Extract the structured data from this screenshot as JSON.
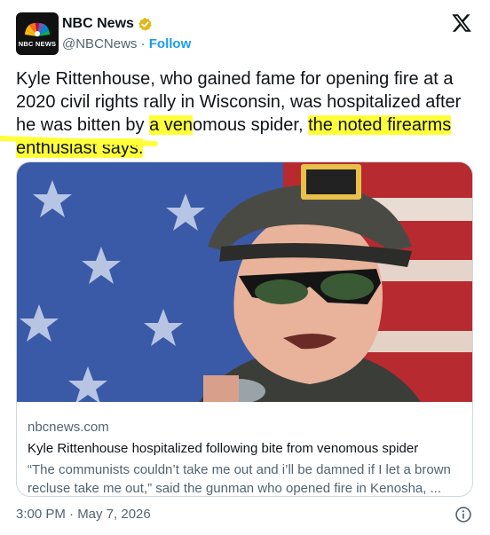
{
  "account": {
    "name": "NBC News",
    "handle": "@NBCNews",
    "separator": "·",
    "follow_label": "Follow",
    "avatar_text": "NBC NEWS"
  },
  "tweet": {
    "segments": {
      "s1": "Kyle Rittenhouse, who gained fame for opening fire at a 2020 civil rights rally in Wisconsin, was hospitalized after he was bitten by ",
      "s2": "a ven",
      "s3": "omous spider, ",
      "s4": "the noted firearms enthusiast says."
    }
  },
  "card": {
    "domain": "nbcnews.com",
    "title": "Kyle Rittenhouse hospitalized following bite from venomous spider",
    "description": "“The communists couldn’t take me out and i’ll be damned if I let a brown recluse take me out,” said the gunman who opened fire in Kenosha, ..."
  },
  "footer": {
    "timestamp": "3:00 PM · May 7, 2026"
  },
  "icons": {
    "verified": "verified-badge-icon",
    "x_logo": "x-logo-icon",
    "info": "info-icon"
  },
  "colors": {
    "highlight": "#ffff3a",
    "link_blue": "#1d9bf0",
    "verified_gold": "#e2b719",
    "text_gray": "#536471"
  }
}
